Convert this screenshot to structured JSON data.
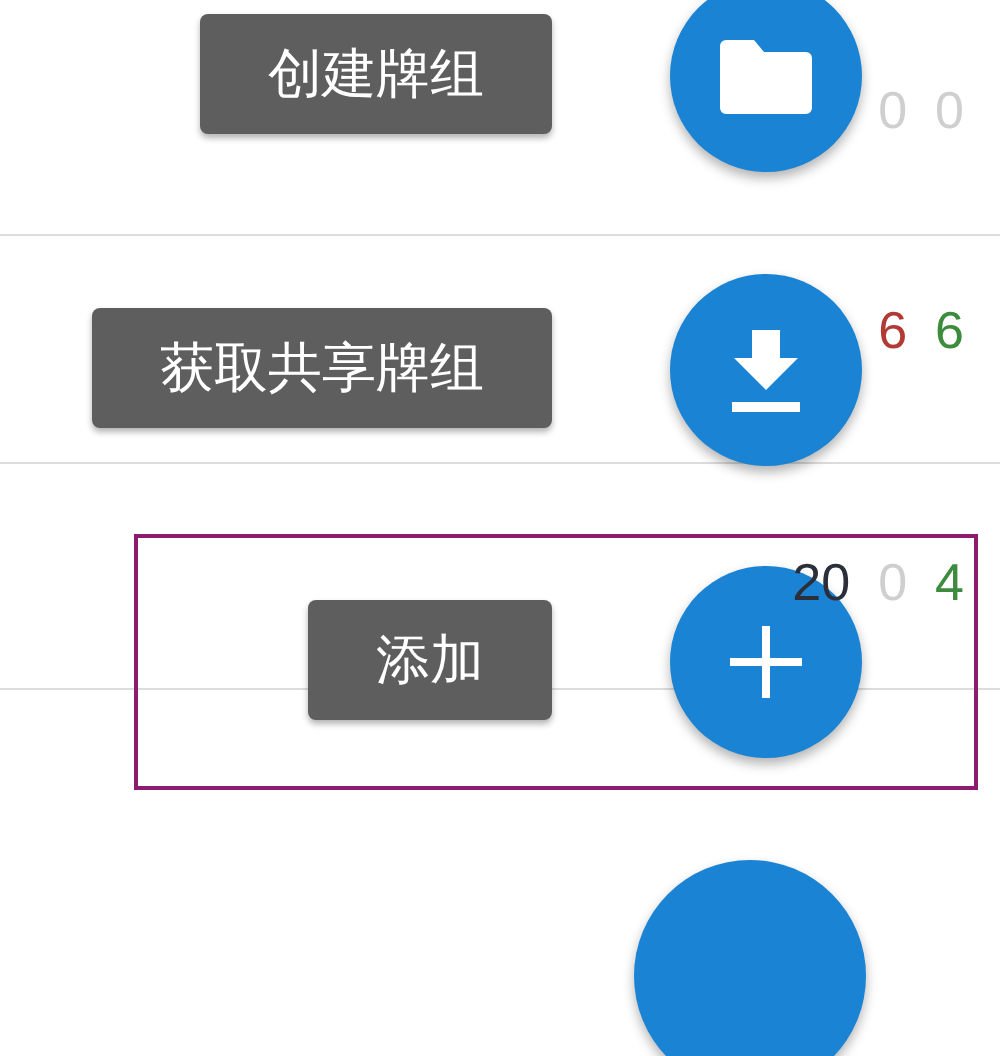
{
  "deck_rows": [
    {
      "counts": [
        {
          "text": "0",
          "kind": "muted"
        },
        {
          "text": "0",
          "kind": "muted"
        }
      ]
    },
    {
      "counts": [
        {
          "text": "6",
          "kind": "learn"
        },
        {
          "text": "6",
          "kind": "review"
        }
      ]
    },
    {
      "counts": [
        {
          "text": "20",
          "kind": "new"
        },
        {
          "text": "0",
          "kind": "muted"
        },
        {
          "text": "4",
          "kind": "review"
        }
      ]
    }
  ],
  "fab_menu": {
    "items": [
      {
        "label": "创建牌组",
        "kind": "folder",
        "highlighted": false
      },
      {
        "label": "获取共享牌组",
        "kind": "download",
        "highlighted": false
      },
      {
        "label": "添加",
        "kind": "add",
        "highlighted": true
      }
    ]
  }
}
